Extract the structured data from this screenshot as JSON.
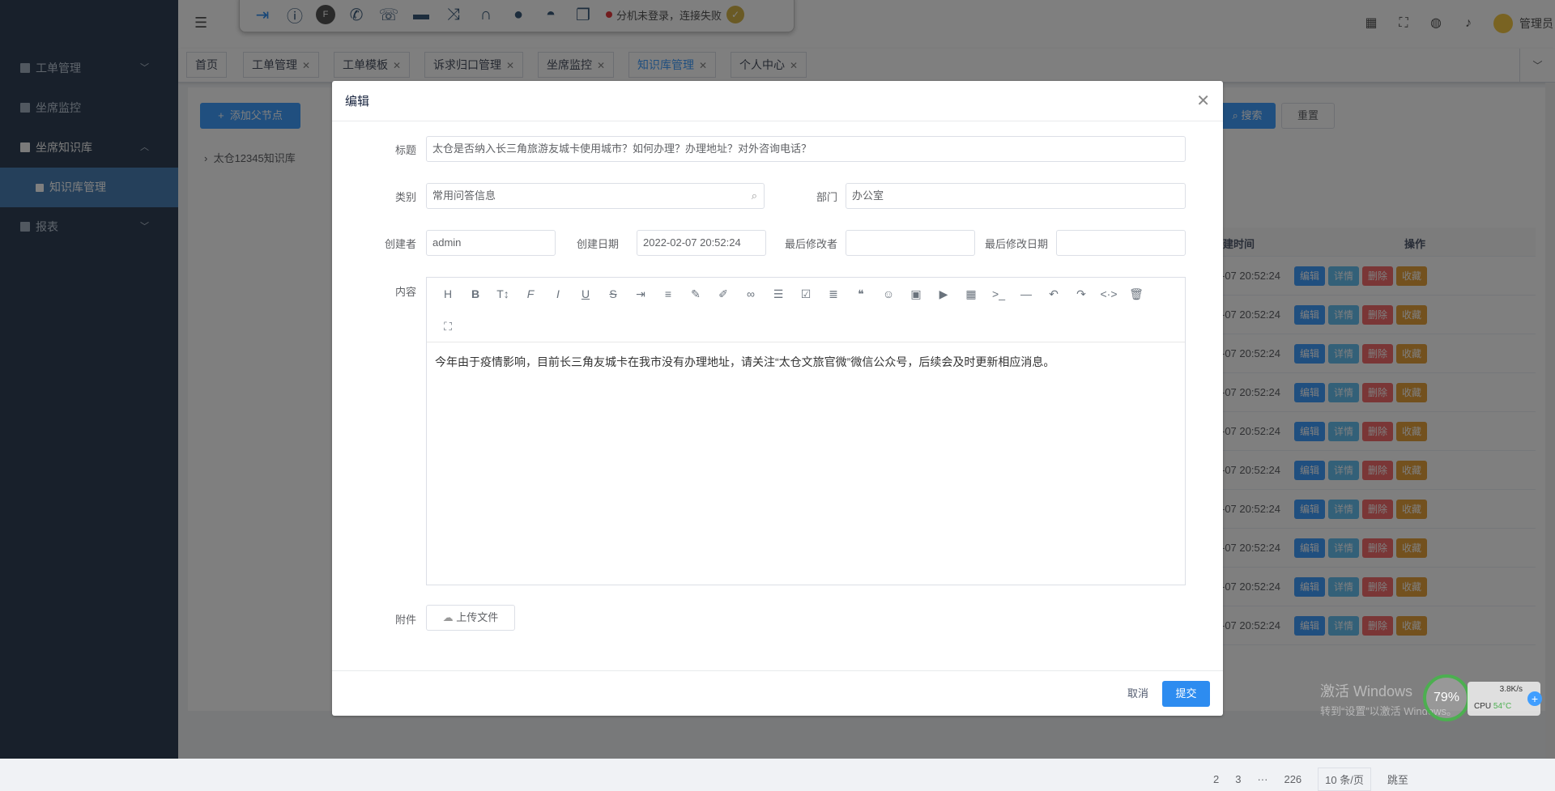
{
  "sidebar": {
    "items": [
      {
        "label": "工单管理",
        "icon": "document-icon",
        "arrow": "﹀"
      },
      {
        "label": "坐席监控",
        "icon": "monitor-icon",
        "arrow": ""
      },
      {
        "label": "坐席知识库",
        "icon": "book-icon",
        "arrow": "︿"
      },
      {
        "label": "知识库管理",
        "icon": "book-icon",
        "arrow": ""
      },
      {
        "label": "报表",
        "icon": "chart-icon",
        "arrow": "﹀"
      }
    ]
  },
  "toolbar": {
    "status_text": "分机未登录，连接失败",
    "icons": [
      "sign-in-icon",
      "info-icon",
      "free-icon",
      "phone-icon",
      "hangup-icon",
      "car-icon",
      "transfer-icon",
      "headset-icon",
      "chat-icon",
      "end-call-icon",
      "copy-icon"
    ]
  },
  "header": {
    "user": "管理员"
  },
  "tabs": [
    {
      "label": "首页",
      "closable": false
    },
    {
      "label": "工单管理",
      "closable": true
    },
    {
      "label": "工单模板",
      "closable": true
    },
    {
      "label": "诉求归口管理",
      "closable": true
    },
    {
      "label": "坐席监控",
      "closable": true
    },
    {
      "label": "知识库管理",
      "closable": true
    },
    {
      "label": "个人中心",
      "closable": true
    }
  ],
  "main": {
    "add_button": "添加父节点",
    "tree_root": "太仓12345知识库",
    "search_button": "搜索",
    "reset_button": "重置",
    "col_time": "建时间",
    "col_ops": "操作",
    "row_time": "-07 20:52:24",
    "ops": [
      "编辑",
      "详情",
      "删除",
      "收藏"
    ],
    "row_count": 10,
    "pager": {
      "p2": "2",
      "p3": "3",
      "ellipsis": "···",
      "last": "226",
      "size": "10 条/页",
      "jump": "跳至"
    }
  },
  "dialog": {
    "title": "编辑",
    "fields": {
      "title_label": "标题",
      "title_value": "太仓是否纳入长三角旅游友城卡使用城市？如何办理？办理地址？对外咨询电话？",
      "category_label": "类别",
      "category_value": "常用问答信息",
      "dept_label": "部门",
      "dept_value": "办公室",
      "creator_label": "创建者",
      "creator_value": "admin",
      "created_label": "创建日期",
      "created_value": "2022-02-07 20:52:24",
      "modifier_label": "最后修改者",
      "modifier_value": "",
      "modified_label": "最后修改日期",
      "modified_value": "",
      "content_label": "内容",
      "content_value": "今年由于疫情影响，目前长三角友城卡在我市没有办理地址，请关注“太仓文旅官微”微信公众号，后续会及时更新相应消息。",
      "attach_label": "附件",
      "upload_button": "上传文件"
    },
    "cancel": "取消",
    "submit": "提交"
  },
  "overlay": {
    "watermark_line1": "激活 Windows",
    "watermark_line2": "转到“设置”以激活 Windows。",
    "ball_value": "79%",
    "net_speed": "3.8K/s",
    "cpu_label": "CPU",
    "cpu_temp": "54°C"
  },
  "colors": {
    "primary": "#409eff",
    "sidebar_bg": "#304156",
    "danger": "#f56c6c",
    "warning": "#e6a23c"
  }
}
